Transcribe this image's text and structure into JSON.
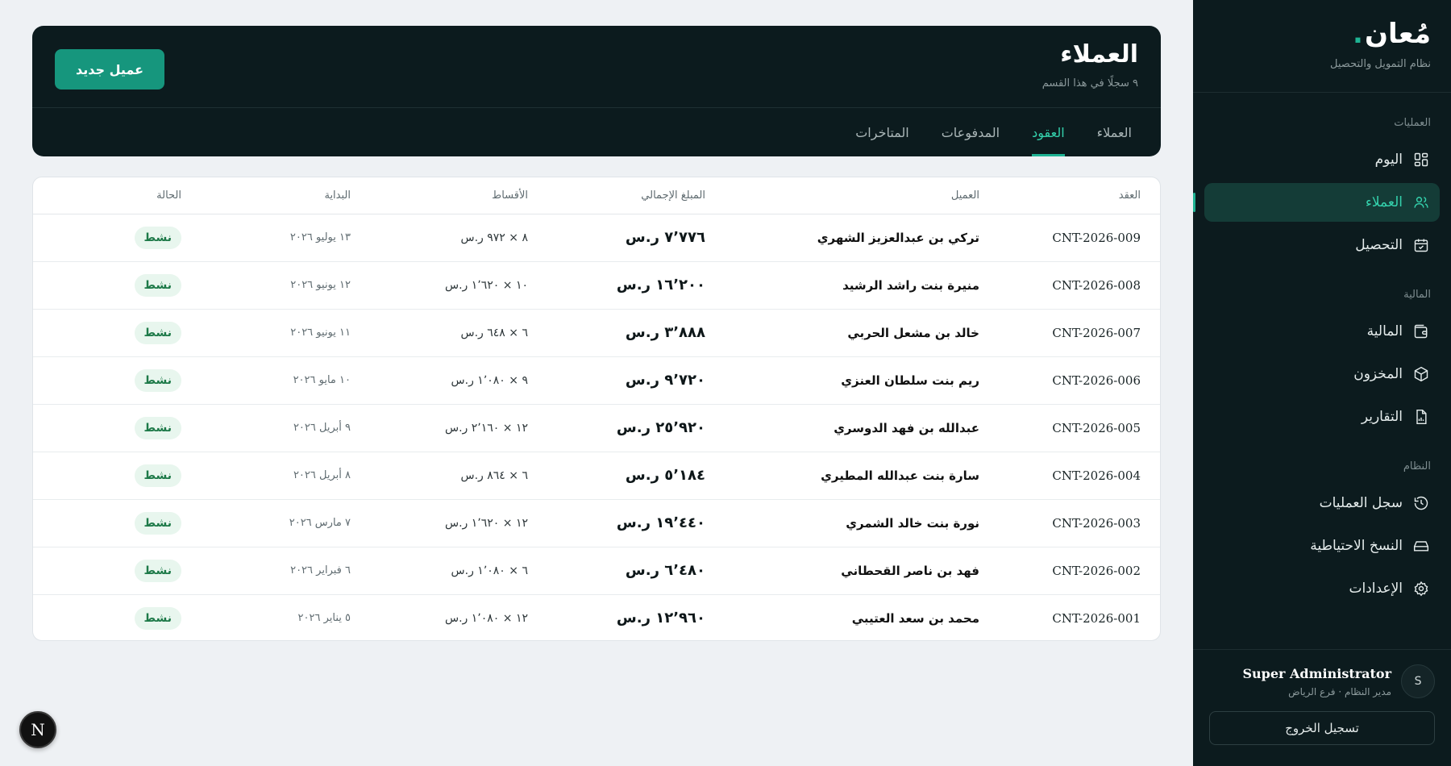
{
  "brand": {
    "name": "مُعان",
    "dot": ".",
    "subtitle": "نظام التمويل والتحصيل"
  },
  "sidebar": {
    "groups": [
      {
        "title": "العمليات",
        "items": [
          {
            "label": "اليوم",
            "icon": "dashboard-grid-icon"
          },
          {
            "label": "العملاء",
            "icon": "users-icon",
            "active": true
          },
          {
            "label": "التحصيل",
            "icon": "calendar-check-icon"
          }
        ]
      },
      {
        "title": "المالية",
        "items": [
          {
            "label": "المالية",
            "icon": "wallet-icon"
          },
          {
            "label": "المخزون",
            "icon": "box-icon"
          },
          {
            "label": "التقارير",
            "icon": "report-file-icon"
          }
        ]
      },
      {
        "title": "النظام",
        "items": [
          {
            "label": "سجل العمليات",
            "icon": "history-icon"
          },
          {
            "label": "النسخ الاحتياطية",
            "icon": "hard-drive-icon"
          },
          {
            "label": "الإعدادات",
            "icon": "gear-icon"
          }
        ]
      }
    ]
  },
  "user": {
    "initial": "S",
    "name": "Super Administrator",
    "role": "مدير النظام · فرع الرياض",
    "logout_label": "تسجيل الخروج"
  },
  "header": {
    "title": "العملاء",
    "subtitle": "٩ سجلًا في هذا القسم",
    "new_button_label": "عميل جديد",
    "tabs": [
      {
        "label": "العملاء",
        "active": false
      },
      {
        "label": "العقود",
        "active": true
      },
      {
        "label": "المدفوعات",
        "active": false
      },
      {
        "label": "المتاخرات",
        "active": false
      }
    ]
  },
  "table": {
    "columns": [
      "العقد",
      "العميل",
      "المبلغ الإجمالي",
      "الأقساط",
      "البداية",
      "الحالة"
    ],
    "rows": [
      {
        "code": "CNT-2026-009",
        "client": "تركي بن عبدالعزيز الشهري",
        "amount": "٧٬٧٧٦ ر.س",
        "installments": "٨ × ٩٧٢ ر.س",
        "start": "١٣ يوليو ٢٠٢٦",
        "status": "نشط"
      },
      {
        "code": "CNT-2026-008",
        "client": "منيرة بنت راشد الرشيد",
        "amount": "١٦٬٢٠٠ ر.س",
        "installments": "١٠ × ١٬٦٢٠ ر.س",
        "start": "١٢ يونيو ٢٠٢٦",
        "status": "نشط"
      },
      {
        "code": "CNT-2026-007",
        "client": "خالد بن مشعل الحربي",
        "amount": "٣٬٨٨٨ ر.س",
        "installments": "٦ × ٦٤٨ ر.س",
        "start": "١١ يونيو ٢٠٢٦",
        "status": "نشط"
      },
      {
        "code": "CNT-2026-006",
        "client": "ريم بنت سلطان العنزي",
        "amount": "٩٬٧٢٠ ر.س",
        "installments": "٩ × ١٬٠٨٠ ر.س",
        "start": "١٠ مايو ٢٠٢٦",
        "status": "نشط"
      },
      {
        "code": "CNT-2026-005",
        "client": "عبدالله بن فهد الدوسري",
        "amount": "٢٥٬٩٢٠ ر.س",
        "installments": "١٢ × ٢٬١٦٠ ر.س",
        "start": "٩ أبريل ٢٠٢٦",
        "status": "نشط"
      },
      {
        "code": "CNT-2026-004",
        "client": "سارة بنت عبدالله المطيري",
        "amount": "٥٬١٨٤ ر.س",
        "installments": "٦ × ٨٦٤ ر.س",
        "start": "٨ أبريل ٢٠٢٦",
        "status": "نشط"
      },
      {
        "code": "CNT-2026-003",
        "client": "نورة بنت خالد الشمري",
        "amount": "١٩٬٤٤٠ ر.س",
        "installments": "١٢ × ١٬٦٢٠ ر.س",
        "start": "٧ مارس ٢٠٢٦",
        "status": "نشط"
      },
      {
        "code": "CNT-2026-002",
        "client": "فهد بن ناصر القحطاني",
        "amount": "٦٬٤٨٠ ر.س",
        "installments": "٦ × ١٬٠٨٠ ر.س",
        "start": "٦ فبراير ٢٠٢٦",
        "status": "نشط"
      },
      {
        "code": "CNT-2026-001",
        "client": "محمد بن سعد العتيبي",
        "amount": "١٢٬٩٦٠ ر.س",
        "installments": "١٢ × ١٬٠٨٠ ر.س",
        "start": "٥ يناير ٢٠٢٦",
        "status": "نشط"
      }
    ]
  },
  "fab": {
    "label": "N"
  },
  "colors": {
    "accent": "#1fb393",
    "dark_panel": "#0c1b1e",
    "status_active": "#1e7a49"
  }
}
